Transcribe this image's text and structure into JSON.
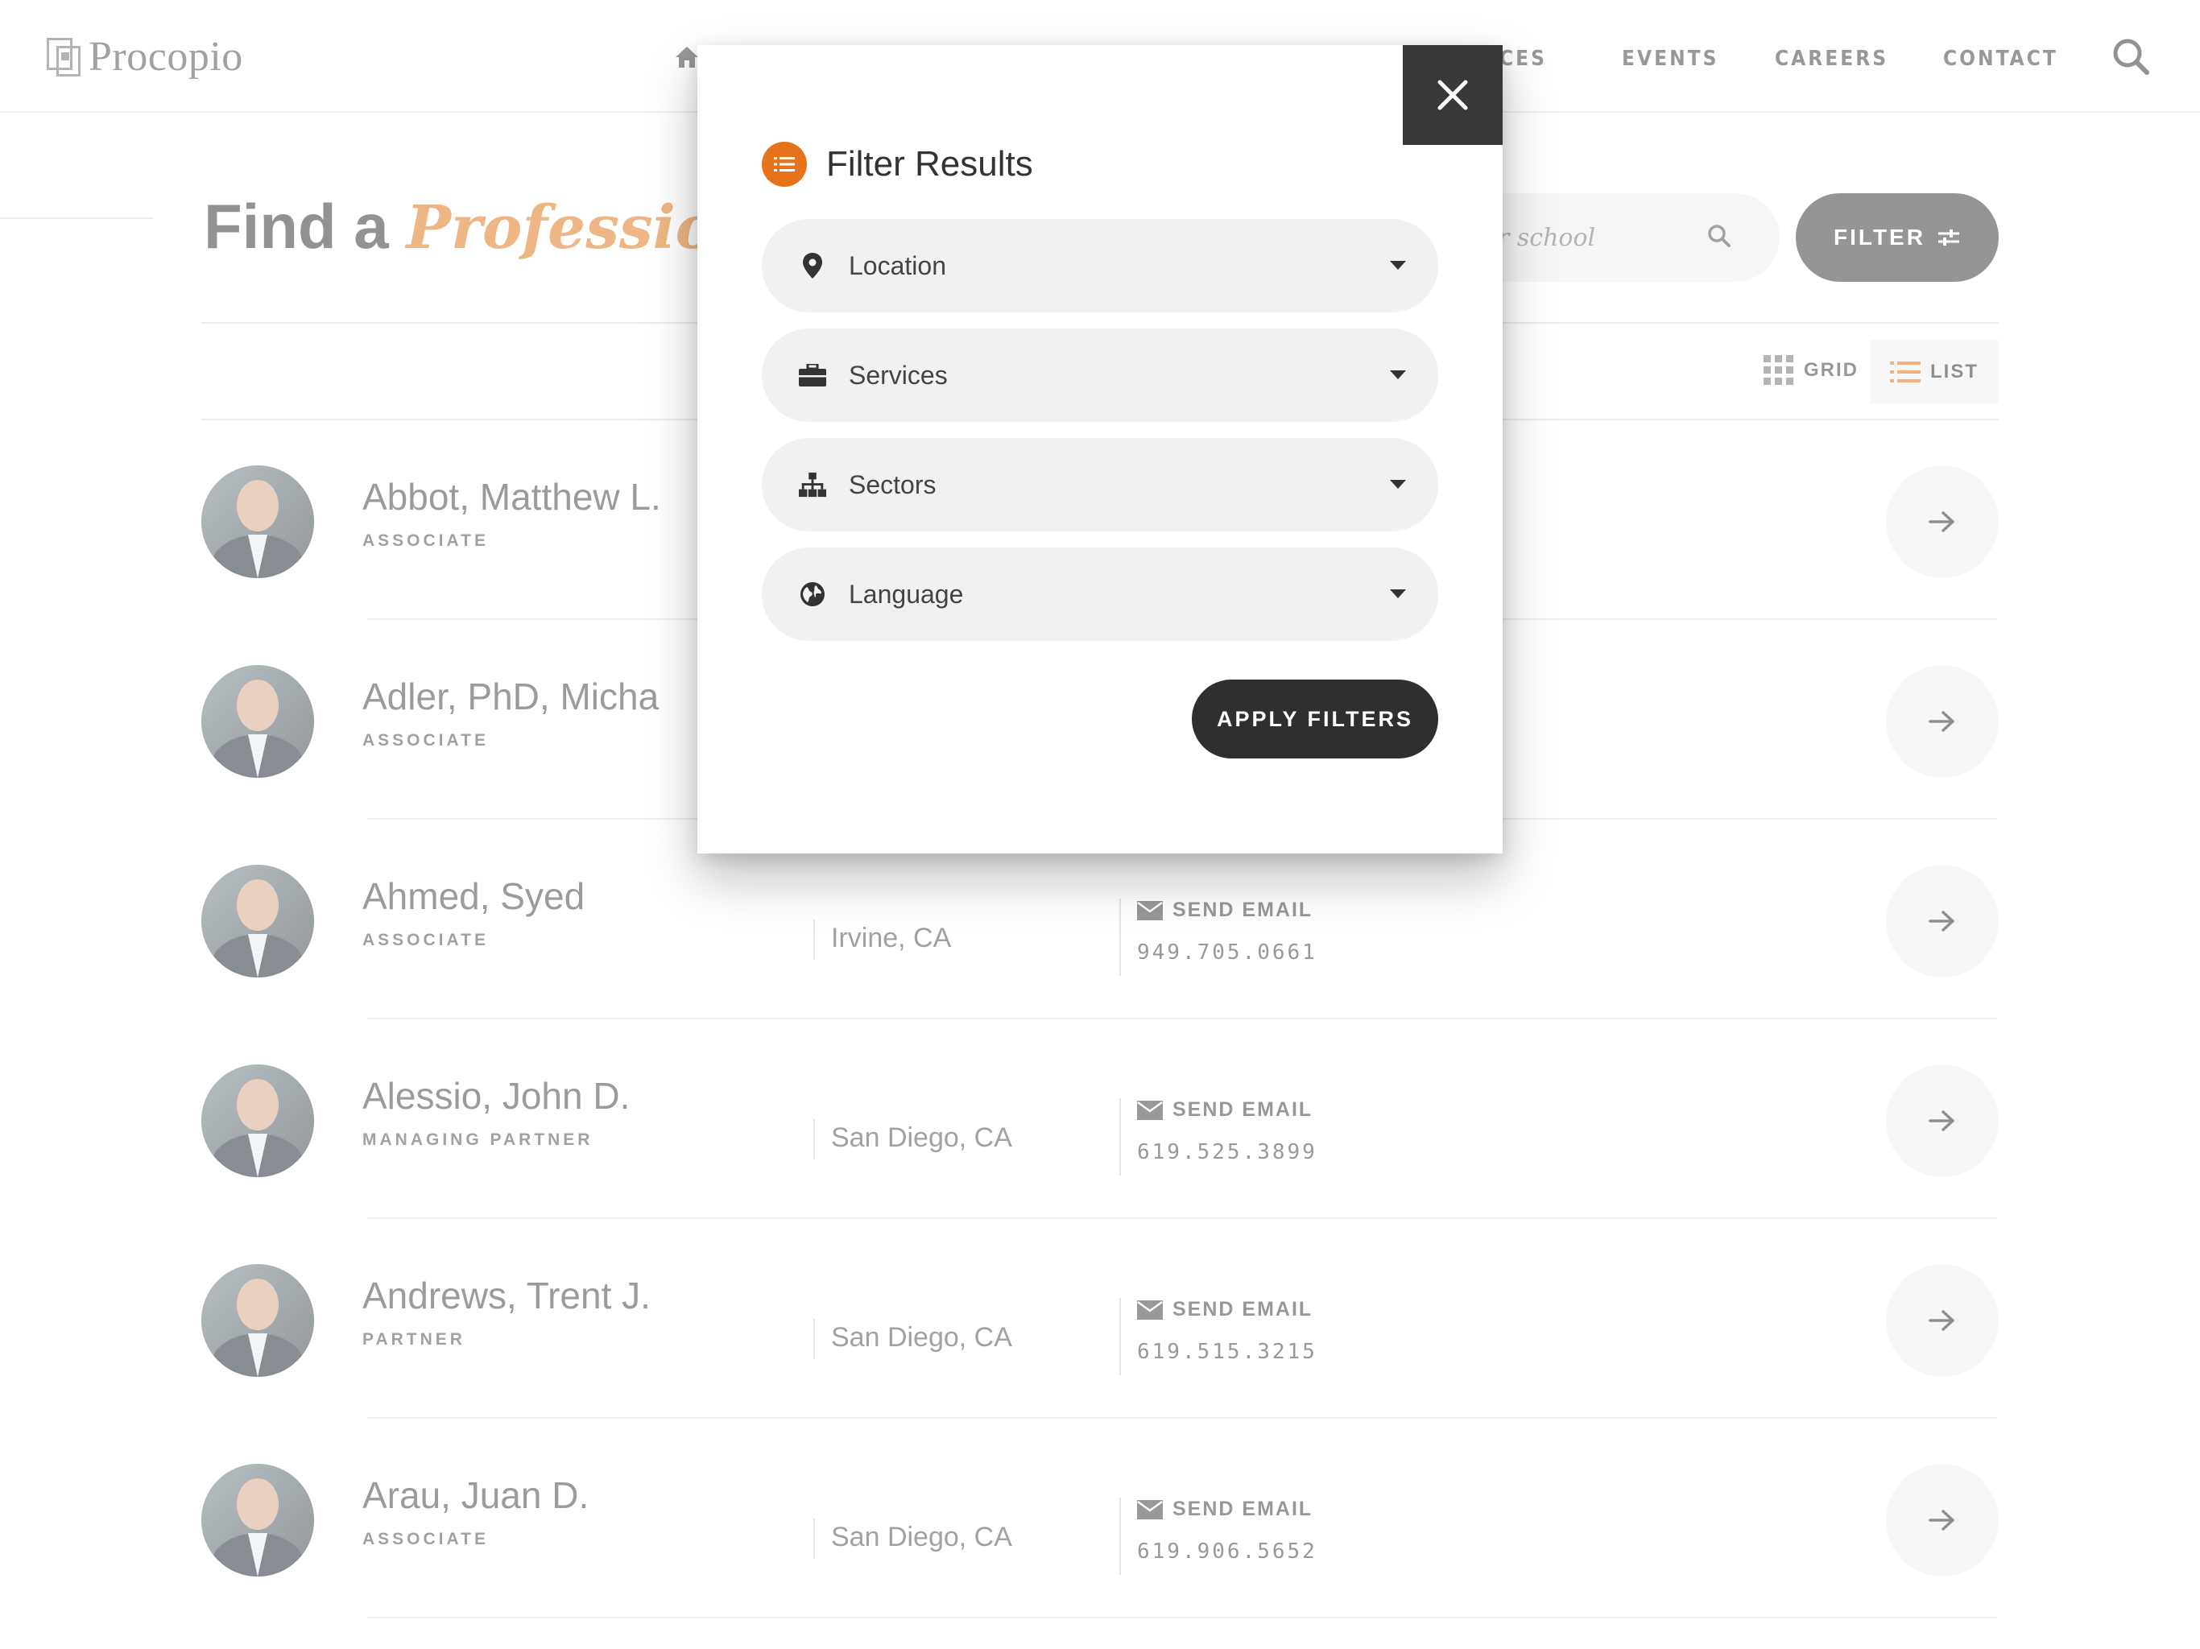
{
  "header": {
    "logo_text": "Procopio",
    "nav": [
      "CES",
      "EVENTS",
      "CAREERS",
      "CONTACT"
    ]
  },
  "page": {
    "title_plain": "Find a ",
    "title_accent": "Professional",
    "search_placeholder": "r school",
    "filter_label": "FILTER",
    "view_grid_label": "GRID",
    "view_list_label": "LIST"
  },
  "people": [
    {
      "name": "Abbot, Matthew L.",
      "title": "ASSOCIATE",
      "location": "",
      "email_label": "",
      "phone": ""
    },
    {
      "name": "Adler, PhD, Micha",
      "title": "ASSOCIATE",
      "location": "",
      "email_label": "",
      "phone": ""
    },
    {
      "name": "Ahmed, Syed",
      "title": "ASSOCIATE",
      "location": "Irvine, CA",
      "email_label": "SEND EMAIL",
      "phone": "949.705.0661"
    },
    {
      "name": "Alessio, John D.",
      "title": "MANAGING PARTNER",
      "location": "San Diego, CA",
      "email_label": "SEND EMAIL",
      "phone": "619.525.3899"
    },
    {
      "name": "Andrews, Trent J.",
      "title": "PARTNER",
      "location": "San Diego, CA",
      "email_label": "SEND EMAIL",
      "phone": "619.515.3215"
    },
    {
      "name": "Arau, Juan D.",
      "title": "ASSOCIATE",
      "location": "San Diego, CA",
      "email_label": "SEND EMAIL",
      "phone": "619.906.5652"
    }
  ],
  "modal": {
    "title": "Filter Results",
    "dropdowns": [
      {
        "label": "Location",
        "icon": "map-pin-icon"
      },
      {
        "label": "Services",
        "icon": "briefcase-icon"
      },
      {
        "label": "Sectors",
        "icon": "sitemap-icon"
      },
      {
        "label": "Language",
        "icon": "globe-icon"
      }
    ],
    "apply_label": "APPLY FILTERS"
  },
  "colors": {
    "accent": "#e07b20",
    "dark_button": "#3e3e3e",
    "pill_bg": "#f1f1f1"
  }
}
